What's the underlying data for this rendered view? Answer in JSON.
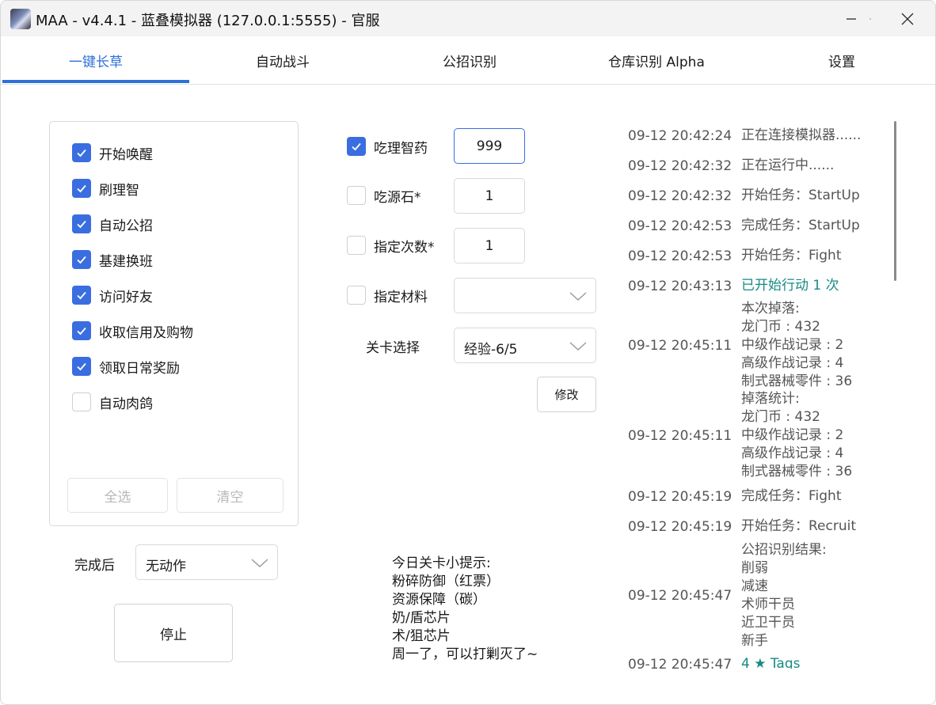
{
  "window": {
    "title": "MAA - v4.4.1 - 蓝叠模拟器 (127.0.0.1:5555) - 官服",
    "controls": [
      "minimize-icon",
      "maximize-icon",
      "close-icon"
    ]
  },
  "tabs": [
    {
      "label": "一键长草",
      "active": true
    },
    {
      "label": "自动战斗",
      "active": false
    },
    {
      "label": "公招识别",
      "active": false
    },
    {
      "label": "仓库识别 Alpha",
      "active": false
    },
    {
      "label": "设置",
      "active": false
    }
  ],
  "tasks": {
    "items": [
      {
        "label": "开始唤醒",
        "checked": true
      },
      {
        "label": "刷理智",
        "checked": true
      },
      {
        "label": "自动公招",
        "checked": true
      },
      {
        "label": "基建换班",
        "checked": true
      },
      {
        "label": "访问好友",
        "checked": true
      },
      {
        "label": "收取信用及购物",
        "checked": true
      },
      {
        "label": "领取日常奖励",
        "checked": true
      },
      {
        "label": "自动肉鸽",
        "checked": false
      }
    ],
    "select_all_label": "全选",
    "clear_label": "清空"
  },
  "after_complete": {
    "label": "完成后",
    "value": "无动作"
  },
  "stop_label": "停止",
  "fight": {
    "medicine": {
      "label": "吃理智药",
      "checked": true,
      "value": "999"
    },
    "stone": {
      "label": "吃源石*",
      "checked": false,
      "value": "1"
    },
    "times": {
      "label": "指定次数*",
      "checked": false,
      "value": "1"
    },
    "material": {
      "label": "指定材料",
      "checked": false,
      "value": ""
    },
    "stage": {
      "label": "关卡选择",
      "value": "经验-6/5"
    },
    "modify_label": "修改"
  },
  "tips": {
    "lines": [
      "今日关卡小提示:",
      "粉碎防御（红票）",
      "资源保障（碳）",
      "奶/盾芯片",
      "术/狙芯片",
      "周一了，可以打剿灭了~"
    ]
  },
  "colors": {
    "accent": "#2e6fd8",
    "checkbox": "#3a6ee0",
    "log_highlight": "#178a83"
  },
  "log": [
    {
      "time": "09-12  20:42:24",
      "lines": [
        "正在连接模拟器......"
      ],
      "highlight": false
    },
    {
      "time": "09-12  20:42:32",
      "lines": [
        "正在运行中......"
      ],
      "highlight": false
    },
    {
      "time": "09-12  20:42:32",
      "lines": [
        "开始任务：StartUp"
      ],
      "highlight": false
    },
    {
      "time": "09-12  20:42:53",
      "lines": [
        "完成任务：StartUp"
      ],
      "highlight": false
    },
    {
      "time": "09-12  20:42:53",
      "lines": [
        "开始任务：Fight"
      ],
      "highlight": false
    },
    {
      "time": "09-12  20:43:13",
      "lines": [
        "已开始行动 1 次"
      ],
      "highlight": true
    },
    {
      "time": "09-12  20:45:11",
      "lines": [
        "本次掉落:",
        "龙门币 : 432",
        "中级作战记录 : 2",
        "高级作战记录 : 4",
        "制式器械零件 : 36"
      ],
      "highlight": false
    },
    {
      "time": "09-12  20:45:11",
      "lines": [
        "掉落统计:",
        "龙门币 : 432",
        "中级作战记录 : 2",
        "高级作战记录 : 4",
        "制式器械零件 : 36"
      ],
      "highlight": false
    },
    {
      "time": "09-12  20:45:19",
      "lines": [
        "完成任务：Fight"
      ],
      "highlight": false
    },
    {
      "time": "09-12  20:45:19",
      "lines": [
        "开始任务：Recruit"
      ],
      "highlight": false
    },
    {
      "time": "09-12  20:45:47",
      "lines": [
        "公招识别结果:",
        "削弱",
        "减速",
        "术师干员",
        "近卫干员",
        "新手"
      ],
      "highlight": false
    },
    {
      "time": "09-12  20:45:47",
      "lines": [
        "4 ★ Tags"
      ],
      "highlight": true
    }
  ]
}
